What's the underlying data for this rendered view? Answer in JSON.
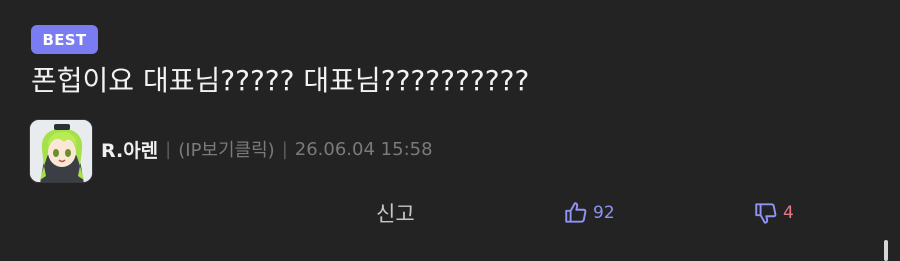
{
  "comment": {
    "badge": "BEST",
    "text": "폰헙이요 대표님????? 대표님??????????",
    "author": "R.아렌",
    "separator": "|",
    "ip_label": "(IP보기클릭)",
    "date": "26.06.04 15:58",
    "report_label": "신고",
    "likes": "92",
    "dislikes": "4"
  },
  "colors": {
    "background": "#232323",
    "badge": "#7a7df2",
    "like": "#8f93f2",
    "dislike": "#e07b82"
  },
  "icons": {
    "like": "thumbs-up-icon",
    "dislike": "thumbs-down-icon"
  }
}
